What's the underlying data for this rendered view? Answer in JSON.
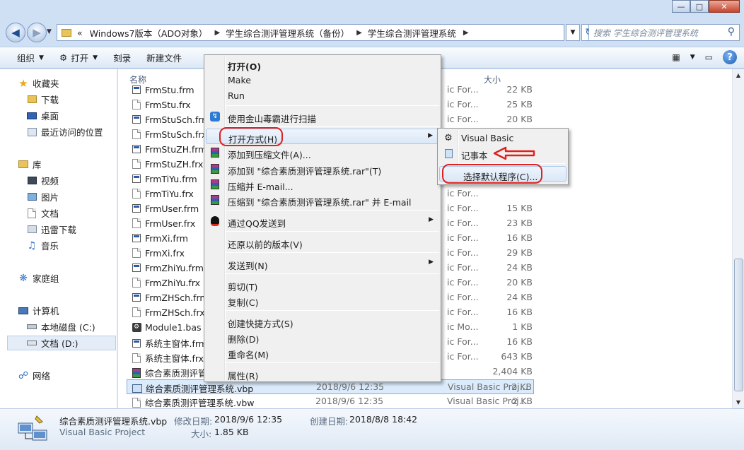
{
  "window": {
    "caption_min": "—",
    "caption_max": "□",
    "caption_close": "✕"
  },
  "address": {
    "overflow": "«",
    "crumbs": [
      "Windows7版本（ADO对象）",
      "学生综合测评管理系统（备份）",
      "学生综合测评管理系统"
    ],
    "search_placeholder": "搜索 学生综合测评管理系统"
  },
  "toolbar": {
    "organize": "组织",
    "open": "打开",
    "burn": "刻录",
    "new_folder": "新建文件"
  },
  "nav": {
    "favorites": "收藏夹",
    "downloads": "下载",
    "desktop": "桌面",
    "recent": "最近访问的位置",
    "libraries": "库",
    "videos": "视频",
    "pictures": "图片",
    "documents": "文档",
    "xunlei": "迅雷下载",
    "music": "音乐",
    "homegroup": "家庭组",
    "computer": "计算机",
    "local_c": "本地磁盘 (C:)",
    "docs_d": "文档 (D:)",
    "network": "网络"
  },
  "columns": {
    "name": "名称",
    "size": "大小"
  },
  "files": [
    {
      "name": "FrmStu.frm",
      "type": "ic For...",
      "size": "22 KB",
      "icon": "vb-form-icon"
    },
    {
      "name": "FrmStu.frx",
      "type": "ic For...",
      "size": "25 KB",
      "icon": "file-icon"
    },
    {
      "name": "FrmStuSch.frm",
      "type": "ic For...",
      "size": "20 KB",
      "icon": "vb-form-icon"
    },
    {
      "name": "FrmStuSch.frx",
      "type": "ic For...",
      "size": "",
      "icon": "file-icon"
    },
    {
      "name": "FrmStuZH.frm",
      "type": "",
      "size": "",
      "icon": "vb-form-icon"
    },
    {
      "name": "FrmStuZH.frx",
      "type": "",
      "size": "",
      "icon": "file-icon"
    },
    {
      "name": "FrmTiYu.frm",
      "type": "ic For...",
      "size": "20 KB",
      "icon": "vb-form-icon"
    },
    {
      "name": "FrmTiYu.frx",
      "type": "ic For...",
      "size": "",
      "icon": "file-icon"
    },
    {
      "name": "FrmUser.frm",
      "type": "ic For...",
      "size": "15 KB",
      "icon": "vb-form-icon"
    },
    {
      "name": "FrmUser.frx",
      "type": "ic For...",
      "size": "23 KB",
      "icon": "file-icon"
    },
    {
      "name": "FrmXi.frm",
      "type": "ic For...",
      "size": "16 KB",
      "icon": "vb-form-icon"
    },
    {
      "name": "FrmXi.frx",
      "type": "ic For...",
      "size": "29 KB",
      "icon": "file-icon"
    },
    {
      "name": "FrmZhiYu.frm",
      "type": "ic For...",
      "size": "24 KB",
      "icon": "vb-form-icon"
    },
    {
      "name": "FrmZhiYu.frx",
      "type": "ic For...",
      "size": "20 KB",
      "icon": "file-icon"
    },
    {
      "name": "FrmZHSch.frm",
      "type": "ic For...",
      "size": "24 KB",
      "icon": "vb-form-icon"
    },
    {
      "name": "FrmZHSch.frx",
      "type": "ic For...",
      "size": "16 KB",
      "icon": "file-icon"
    },
    {
      "name": "Module1.bas",
      "type": "ic Mo...",
      "size": "1 KB",
      "icon": "vb-module-icon"
    },
    {
      "name": "系统主窗体.frm",
      "type": "ic For...",
      "size": "16 KB",
      "icon": "vb-form-icon"
    },
    {
      "name": "系统主窗体.frx",
      "type": "ic For...",
      "size": "643 KB",
      "icon": "file-icon"
    },
    {
      "name": "综合素质测评管",
      "type": "",
      "size": "2,404 KB",
      "icon": "rar-icon"
    },
    {
      "name": "综合素质测评管理系统.vbp",
      "date": "2018/9/6 12:35",
      "type": "Visual Basic Proj...",
      "size": "2 KB",
      "icon": "vb-project-icon"
    },
    {
      "name": "综合素质测评管理系统.vbw",
      "date": "2018/9/6 12:35",
      "type": "Visual Basic Proj...",
      "size": "2 KB",
      "icon": "file-icon"
    }
  ],
  "details": {
    "filename": "综合素质测评管理系统.vbp",
    "filetype": "Visual Basic Project",
    "modified_label": "修改日期:",
    "modified": "2018/9/6 12:35",
    "created_label": "创建日期:",
    "created": "2018/8/8 18:42",
    "size_label": "大小:",
    "size": "1.85 KB"
  },
  "context_menu": {
    "open": "打开(O)",
    "make": "Make",
    "run": "Run",
    "scan": "使用金山毒霸进行扫描",
    "open_with": "打开方式(H)",
    "add_archive": "添加到压缩文件(A)...",
    "add_rar": "添加到 \"综合素质测评管理系统.rar\"(T)",
    "compress_email": "压缩并 E-mail...",
    "compress_rar_email": "压缩到 \"综合素质测评管理系统.rar\" 并 E-mail",
    "send_qq": "通过QQ发送到",
    "restore": "还原以前的版本(V)",
    "send_to": "发送到(N)",
    "cut": "剪切(T)",
    "copy": "复制(C)",
    "shortcut": "创建快捷方式(S)",
    "delete": "删除(D)",
    "rename": "重命名(M)",
    "properties": "属性(R)"
  },
  "submenu": {
    "visual_basic": "Visual Basic",
    "notepad": "记事本",
    "choose_default": "选择默认程序(C)..."
  },
  "colors": {
    "annotation_red": "#e0201c",
    "selection": "#dcebfc",
    "menu_bg": "#f0f0f0"
  }
}
